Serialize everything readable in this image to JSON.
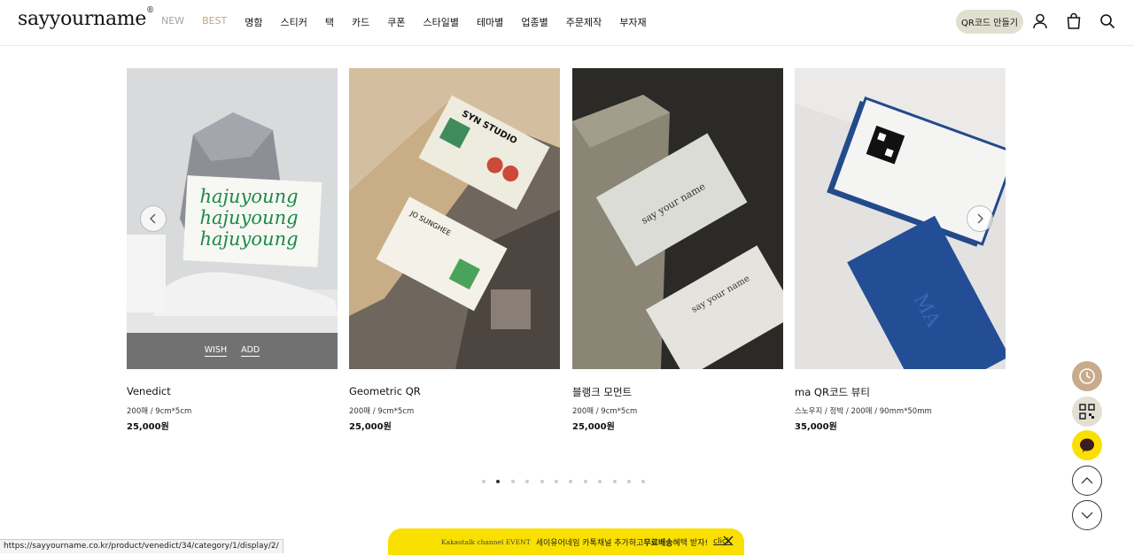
{
  "header": {
    "logo_text": "sayyourname",
    "logo_mark": "®",
    "nav": [
      "NEW",
      "BEST",
      "명함",
      "스티커",
      "택",
      "카드",
      "쿠폰",
      "스타일별",
      "테마별",
      "업종별",
      "주문제작",
      "부자재"
    ],
    "qr_button": "QR코드 만들기",
    "icons": [
      "user-icon",
      "bag-icon",
      "search-icon"
    ]
  },
  "products": [
    {
      "name": "Venedict",
      "spec": "200매 / 9cm*5cm",
      "price": "25,000원",
      "image_text": [
        "hajuyoung",
        "hajuyoung",
        "hajuyoung"
      ],
      "wish": "WISH",
      "add": "ADD"
    },
    {
      "name": "Geometric QR",
      "spec": "200매 / 9cm*5cm",
      "price": "25,000원",
      "image_text": [
        "SYN STUDIO",
        "JO SUNGHEE"
      ]
    },
    {
      "name": "블랭크 모먼트",
      "spec": "200매 / 9cm*5cm",
      "price": "25,000원",
      "image_text": [
        "say your name",
        "say your name"
      ]
    },
    {
      "name": "ma QR코드 뷰티",
      "spec": "스노우지 / 정박 / 200매 / 90mm*50mm",
      "price": "35,000원",
      "image_text": [
        "MA"
      ]
    }
  ],
  "pagination": {
    "count": 12,
    "active_index": 1
  },
  "floating_buttons": [
    "recent-clock-icon",
    "qr-code-icon",
    "kakao-chat-icon",
    "scroll-up-icon",
    "scroll-down-icon"
  ],
  "status_url": "https://sayyourname.co.kr/product/venedict/34/category/1/display/2/",
  "banner": {
    "event": "Kakaotalk channel EVENT",
    "text_pre": "세이유어네임 카톡채널 추가하고 ",
    "text_bold": "무료배송",
    "text_post": " 혜택 받자!",
    "click": "click"
  },
  "colors": {
    "best": "#c4a584",
    "qr_button_bg": "#dfe0cf",
    "banner_bg": "#f9e000",
    "float_clock": "#c9aa8c"
  }
}
